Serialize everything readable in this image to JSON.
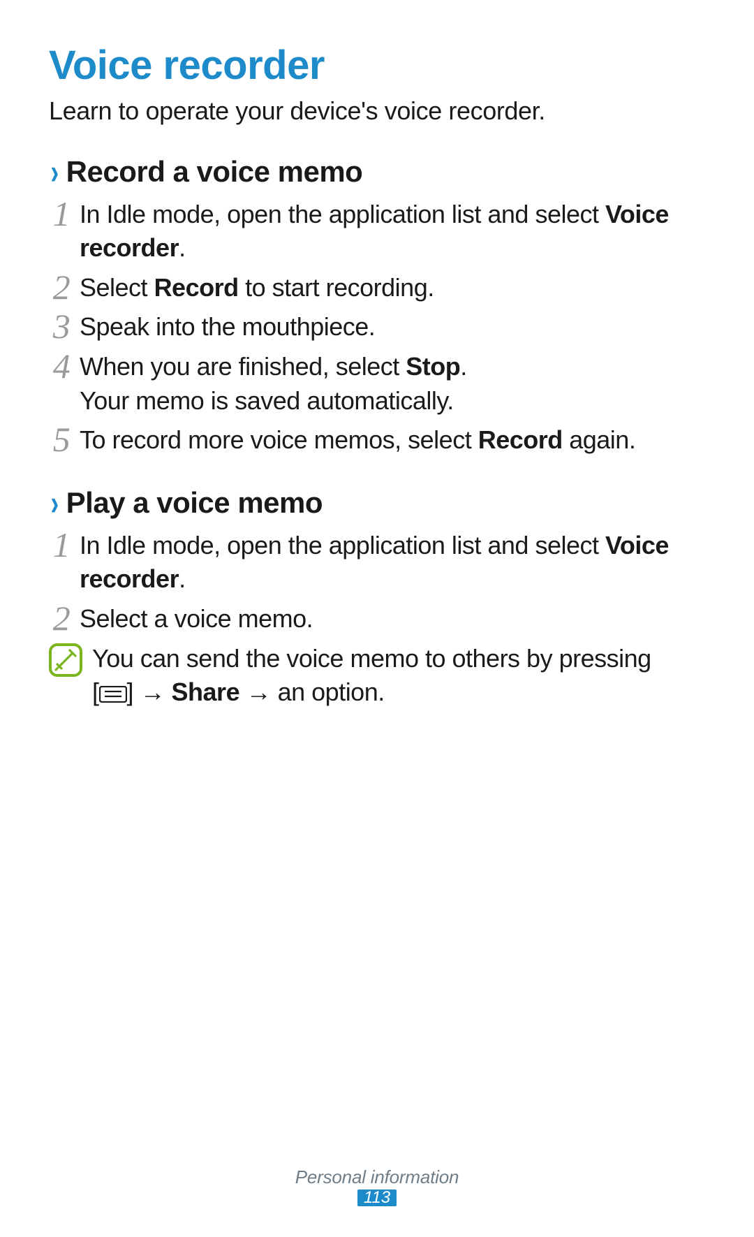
{
  "title": "Voice recorder",
  "intro": "Learn to operate your device's voice recorder.",
  "section1": {
    "heading": "Record a voice memo",
    "steps": {
      "s1_pre": "In Idle mode, open the application list and select ",
      "s1_bold": "Voice recorder",
      "s1_post": ".",
      "s2_pre": "Select ",
      "s2_bold": "Record",
      "s2_post": " to start recording.",
      "s3": "Speak into the mouthpiece.",
      "s4_pre": "When you are finished, select ",
      "s4_bold": "Stop",
      "s4_mid": ".",
      "s4_line2": "Your memo is saved automatically.",
      "s5_pre": "To record more voice memos, select ",
      "s5_bold": "Record",
      "s5_post": " again."
    }
  },
  "section2": {
    "heading": "Play a voice memo",
    "steps": {
      "s1_pre": "In Idle mode, open the application list and select ",
      "s1_bold": "Voice recorder",
      "s1_post": ".",
      "s2": "Select a voice memo."
    },
    "note": {
      "line1": "You can send the voice memo to others by pressing",
      "line2_pre": "[",
      "line2_mid": "] → ",
      "line2_bold": "Share",
      "line2_post": " → an option."
    }
  },
  "footer": {
    "category": "Personal information",
    "page": "113"
  }
}
